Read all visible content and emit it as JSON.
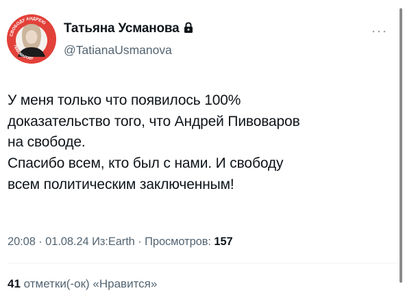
{
  "author": {
    "name": "Татьяна Усманова",
    "handle": "@TatianaUsmanova",
    "avatar_badge_top": "СВОБОДУ АНДРЕЮ",
    "avatar_badge_bottom": "ПИВОВАРОВУ",
    "protected_icon": "lock-icon"
  },
  "tweet": {
    "lines": [
      "У меня только что появилось 100%",
      "доказательство того, что Андрей Пивоваров",
      "на свободе.",
      "Спасибо всем, кто был с нами.  И свободу",
      "всем политическим заключенным!"
    ]
  },
  "meta": {
    "time": "20:08",
    "sep1": " · ",
    "date": "01.08.24",
    "source_prefix": " Из:",
    "source": "Earth",
    "sep2": " · ",
    "views_label": "Просмотров: ",
    "views_count": "157"
  },
  "likes": {
    "count": "41",
    "label": " отметки(-ок) «Нравится»"
  },
  "more_icon": "more-horizontal-icon",
  "colors": {
    "text": "#0f1419",
    "secondary": "#536471",
    "avatar_ring": "#e2413a",
    "divider": "#eff3f4"
  }
}
